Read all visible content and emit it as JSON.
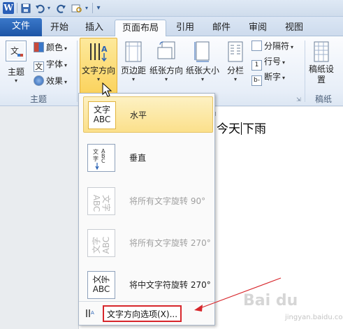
{
  "qat": {
    "logo": "W",
    "save_glyph": "💾",
    "undo_glyph": "↶",
    "redo_glyph": "↺",
    "customize_glyph": "▾"
  },
  "tabs": [
    "文件",
    "开始",
    "插入",
    "页面布局",
    "引用",
    "邮件",
    "审阅",
    "视图"
  ],
  "active_tab": "页面布局",
  "ribbon": {
    "theme_group": {
      "label": "主题",
      "theme_btn": "主题",
      "colors": "颜色",
      "fonts": "字体",
      "effects": "效果"
    },
    "page_setup_group": {
      "text_direction": "文字方向",
      "margins": "页边距",
      "orientation": "纸张方向",
      "size": "纸张大小",
      "columns": "分栏",
      "breaks": "分隔符",
      "line_numbers": "行号",
      "hyphenation": "断字"
    },
    "paper_group": {
      "label": "稿纸",
      "paper_setup": "稿纸设置"
    }
  },
  "document": {
    "text_before": "今天",
    "text_after": "下雨"
  },
  "menu": {
    "items": [
      {
        "label": "水平",
        "icon_text": "文字ABC",
        "state": "selected"
      },
      {
        "label": "垂直",
        "icon_text": "垂直",
        "state": "normal"
      },
      {
        "label": "将所有文字旋转 90°",
        "icon_text": "文字ABC",
        "state": "disabled"
      },
      {
        "label": "将所有文字旋转 270°",
        "icon_text": "文字ABC",
        "state": "disabled"
      },
      {
        "label": "将中文字符旋转 270°",
        "icon_text": "文字ABC",
        "state": "normal"
      }
    ],
    "options_label": "文字方向选项(X)..."
  },
  "colors": {
    "file_tab": "#2a63b5",
    "highlight": "#fbd35e",
    "annotation_red": "#d7262b"
  },
  "watermark": "Bai du",
  "watermark_sub": "jingyan.baidu.com"
}
